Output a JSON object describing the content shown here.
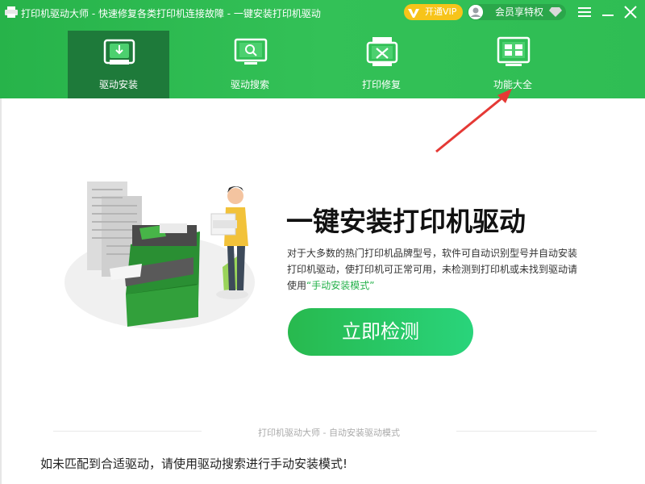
{
  "window": {
    "title": "打印机驱动大师 - 快速修复各类打印机连接故障 - 一键安装打印机驱动",
    "vip_label": "开通VIP",
    "member_label": "会员享特权"
  },
  "nav": {
    "tabs": [
      {
        "label": "驱动安装",
        "icon": "driver-install-icon",
        "active": true
      },
      {
        "label": "驱动搜索",
        "icon": "driver-search-icon",
        "active": false
      },
      {
        "label": "打印修复",
        "icon": "print-repair-icon",
        "active": false
      },
      {
        "label": "功能大全",
        "icon": "all-features-icon",
        "active": false
      }
    ]
  },
  "main": {
    "headline": "一键安装打印机驱动",
    "description_prefix": "对于大多数的热门打印机品牌型号，软件可自动识别型号并自动安装打印机驱动，使打印机可正常可用，未检测到打印机或未找到驱动请使用",
    "description_link": "“手动安装模式”",
    "detect_button": "立即检测",
    "footer_caption": "打印机驱动大师 - 自动安装驱动模式",
    "bottom_note": "如未匹配到合适驱动，请使用驱动搜索进行手动安装模式!"
  },
  "colors": {
    "header_green": "#2fbd54",
    "active_tab": "#1e7a3a",
    "accent_green": "#24b14a",
    "vip_gold": "#f7c41a",
    "annotation_arrow": "#e53935"
  }
}
